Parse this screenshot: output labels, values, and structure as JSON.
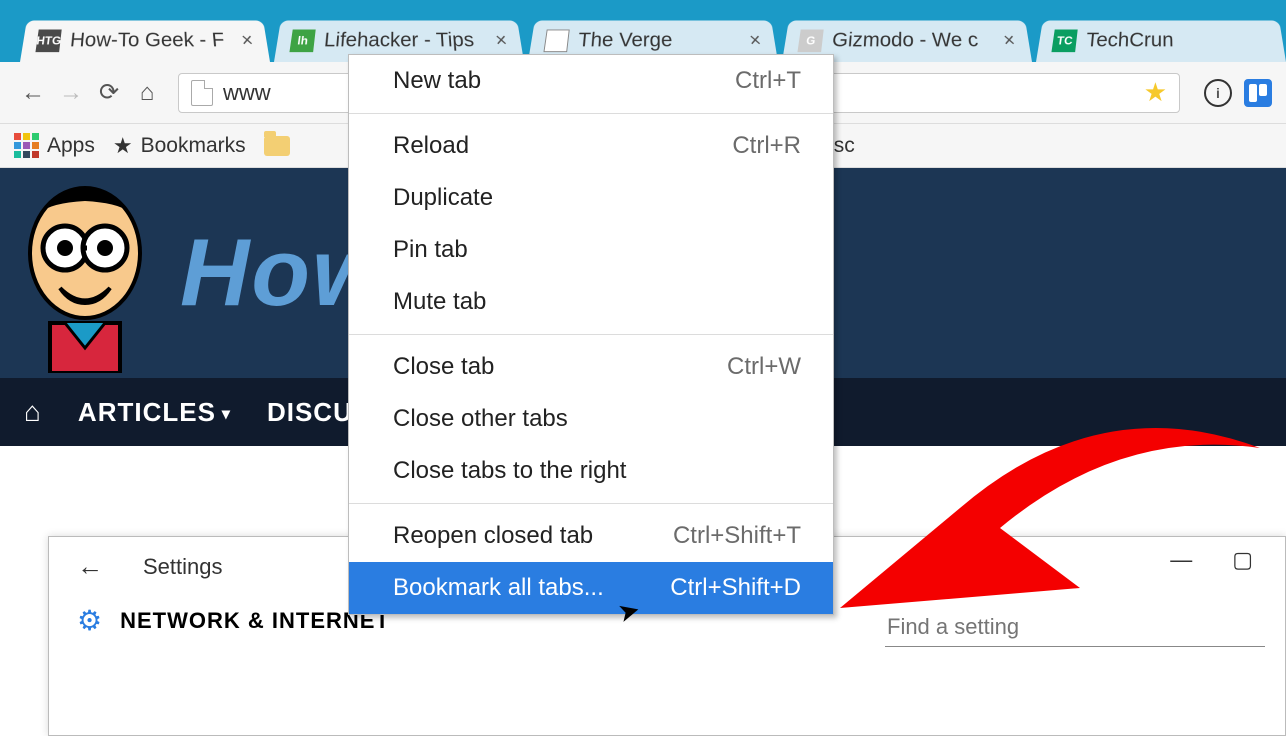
{
  "tabs": [
    {
      "label": "How-To Geek - F",
      "favicon": "HTG",
      "active": true
    },
    {
      "label": "Lifehacker - Tips",
      "favicon": "lh",
      "active": false
    },
    {
      "label": "The Verge",
      "favicon": "▼",
      "active": false
    },
    {
      "label": "Gizmodo - We c",
      "favicon": "G",
      "active": false
    },
    {
      "label": "TechCrun",
      "favicon": "TC",
      "active": false
    }
  ],
  "addressbar": {
    "url_visible": "www"
  },
  "bookmarks_bar": {
    "apps": "Apps",
    "bookmarks": "Bookmarks",
    "misc": "Misc"
  },
  "page": {
    "logo_text": "How-T",
    "nav": {
      "articles": "ARTICLES",
      "discussion": "DISCU"
    }
  },
  "context_menu": {
    "items": [
      {
        "label": "New tab",
        "shortcut": "Ctrl+T"
      },
      {
        "label": "Reload",
        "shortcut": "Ctrl+R"
      },
      {
        "label": "Duplicate",
        "shortcut": ""
      },
      {
        "label": "Pin tab",
        "shortcut": ""
      },
      {
        "label": "Mute tab",
        "shortcut": ""
      },
      {
        "label": "Close tab",
        "shortcut": "Ctrl+W"
      },
      {
        "label": "Close other tabs",
        "shortcut": ""
      },
      {
        "label": "Close tabs to the right",
        "shortcut": ""
      },
      {
        "label": "Reopen closed tab",
        "shortcut": "Ctrl+Shift+T"
      },
      {
        "label": "Bookmark all tabs...",
        "shortcut": "Ctrl+Shift+D",
        "highlight": true
      }
    ]
  },
  "settings_window": {
    "title": "Settings",
    "category": "NETWORK & INTERNET",
    "search_placeholder": "Find a setting"
  }
}
